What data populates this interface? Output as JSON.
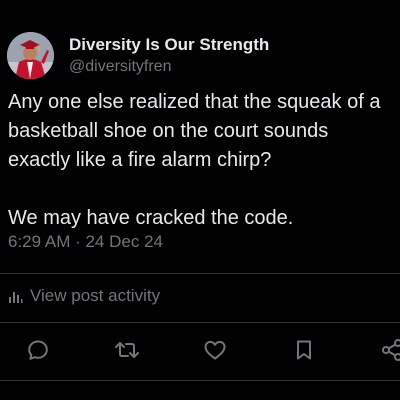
{
  "post": {
    "author": {
      "display_name": "Diversity Is Our Strength",
      "handle": "@diversityfren"
    },
    "text": "Any one else realized that the squeak of a basketball shoe on the court sounds exactly like a fire alarm chirp?\n\nWe may have cracked the code.",
    "timestamp": "6:29 AM · 24 Dec 24",
    "activity_label": "View post activity"
  },
  "actions": {
    "icons": [
      "reply-icon",
      "repost-icon",
      "like-icon",
      "bookmark-icon",
      "share-icon"
    ]
  },
  "colors": {
    "background": "#000000",
    "primary_text": "#e7e9ea",
    "secondary_text": "#71767b",
    "divider": "#2f3336",
    "icon": "#71767b"
  }
}
